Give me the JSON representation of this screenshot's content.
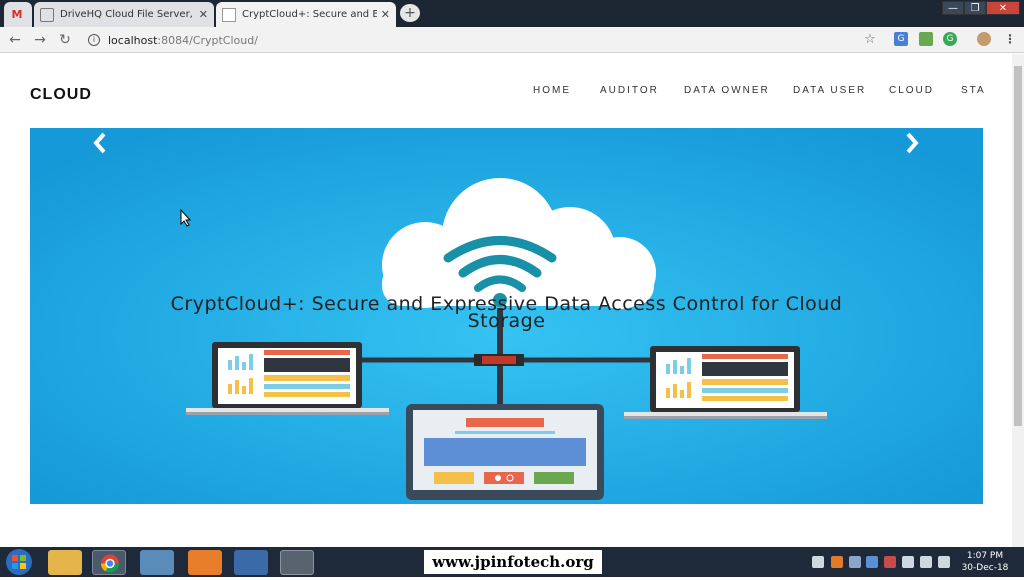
{
  "browser": {
    "tabs": [
      {
        "label": "",
        "icon": "gmail-icon"
      },
      {
        "label": "DriveHQ Cloud File Server, Drive",
        "icon": "drivehq-icon"
      },
      {
        "label": "CryptCloud+: Secure and Expres",
        "icon": "page-icon"
      }
    ],
    "url_host": "localhost",
    "url_path": ":8084/CryptCloud/",
    "new_tab_symbol": "+"
  },
  "site": {
    "brand": "CLOUD",
    "nav": [
      "HOME",
      "AUDITOR",
      "DATA OWNER",
      "DATA USER",
      "CLOUD",
      "STA"
    ]
  },
  "carousel": {
    "caption": "CryptCloud+: Secure and Expressive Data Access Control for Cloud Storage",
    "background_color": "#1ea7e3"
  },
  "taskbar": {
    "watermark": "www.jpinfotech.org",
    "time": "1:07 PM",
    "date": "30-Dec-18"
  }
}
